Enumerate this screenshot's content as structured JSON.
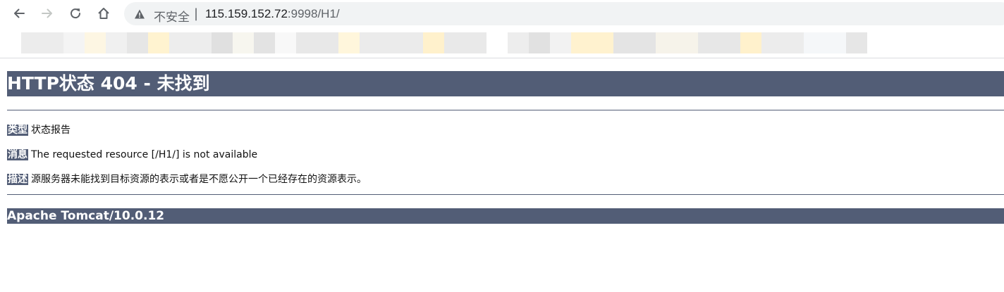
{
  "browser": {
    "security_label": "不安全",
    "separator": "|",
    "url_host": "115.159.152.72",
    "url_rest": ":9998/H1/",
    "icons": [
      "back-arrow-icon",
      "forward-arrow-icon",
      "reload-icon",
      "home-icon",
      "warning-triangle-icon"
    ]
  },
  "page": {
    "title": "HTTP状态 404 - 未找到",
    "rows": [
      {
        "tag": "类型",
        "text": "状态报告"
      },
      {
        "tag": "消息",
        "text": "The requested resource [/H1/] is not available"
      },
      {
        "tag": "描述",
        "text": "源服务器未能找到目标资源的表示或者是不愿公开一个已经存在的资源表示。"
      }
    ],
    "footer": "Apache Tomcat/10.0.12"
  },
  "colors": {
    "tomcat_bar": "#525d76",
    "omnibox_bg": "#f1f3f4",
    "url_host": "#202124",
    "url_rest": "#5f6368"
  }
}
